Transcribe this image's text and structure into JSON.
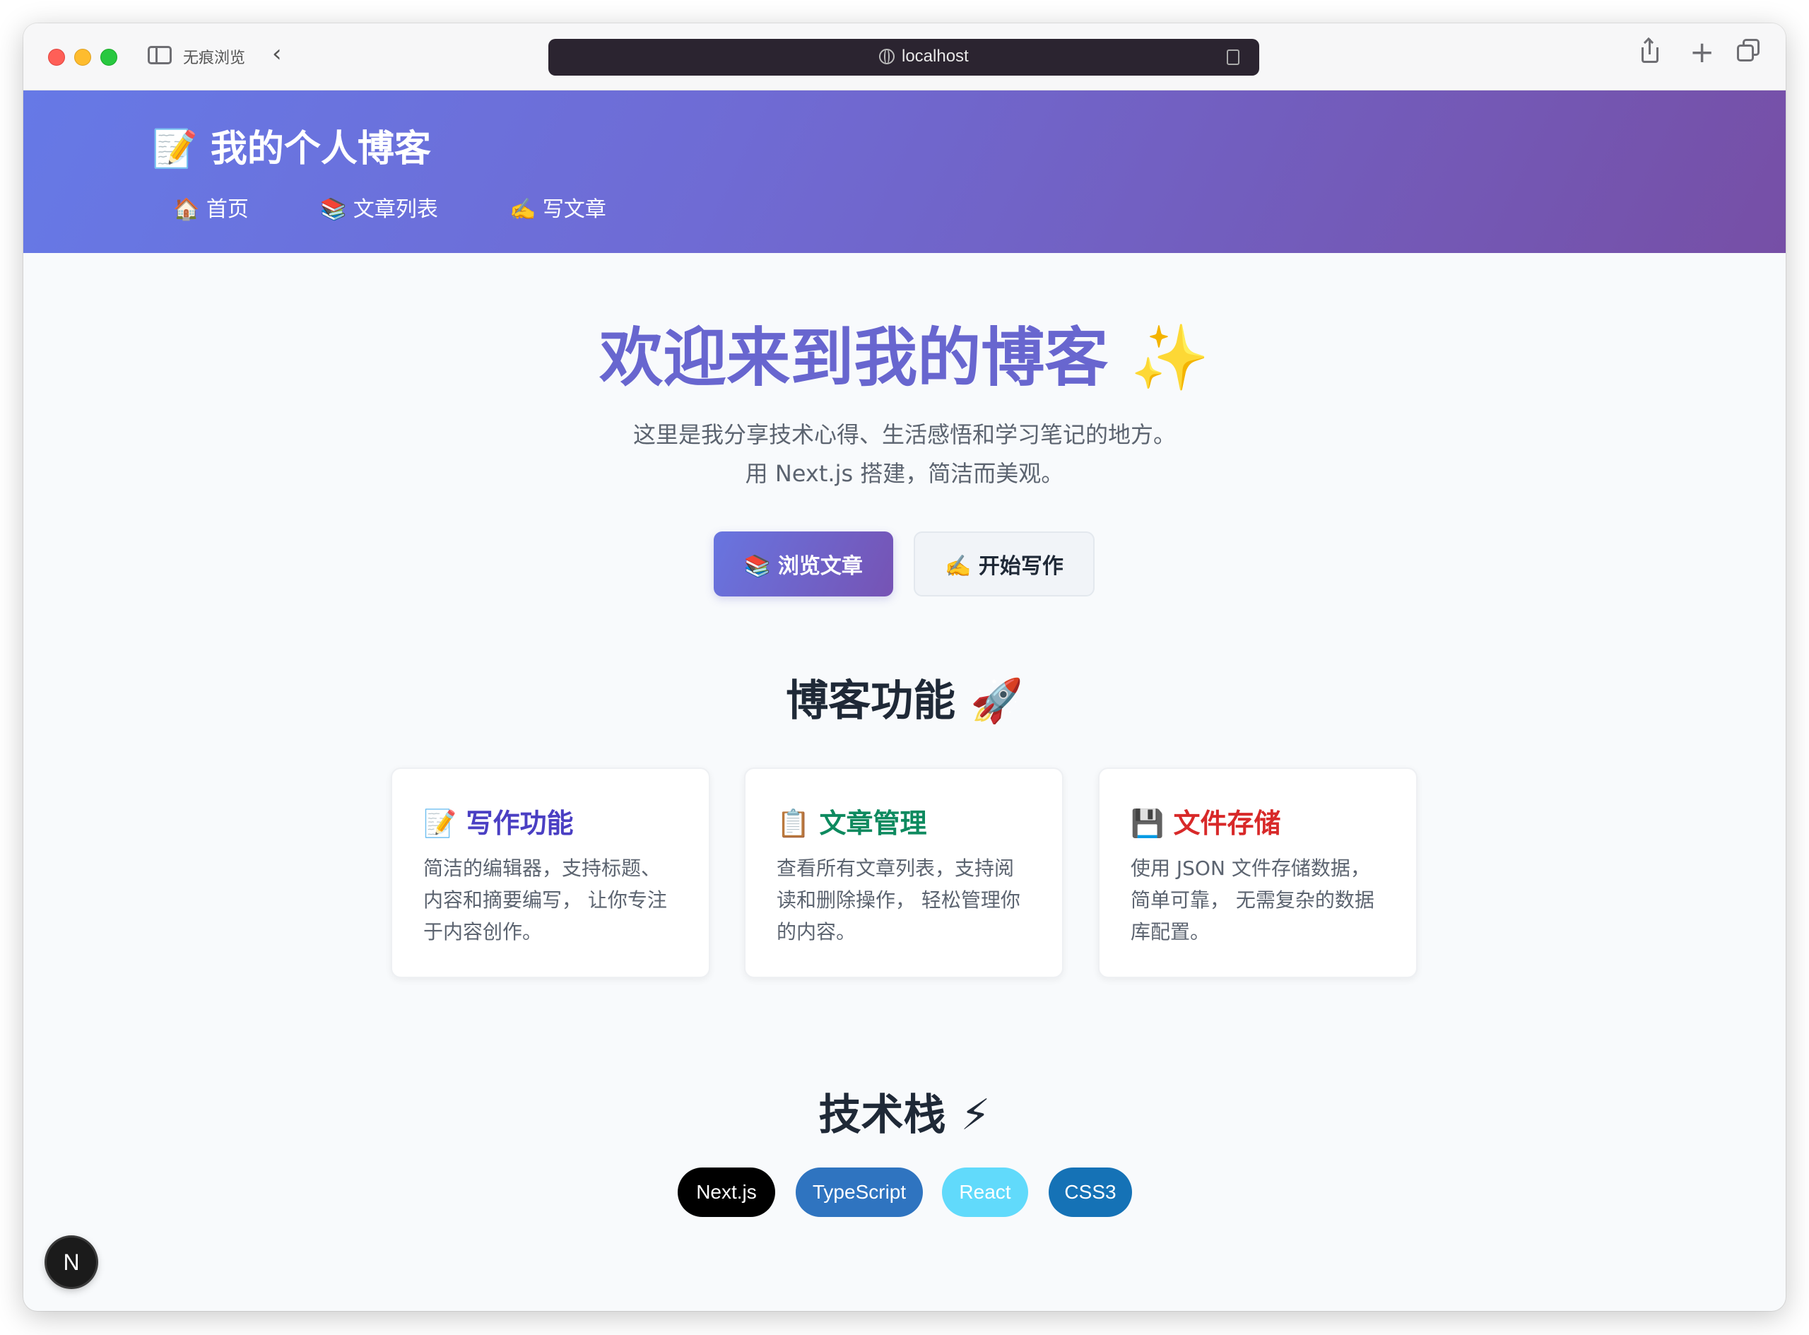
{
  "browser": {
    "private_label": "无痕浏览",
    "url": "localhost"
  },
  "site": {
    "title": "📝 我的个人博客",
    "nav": [
      {
        "label": "🏠 首页"
      },
      {
        "label": "📚 文章列表"
      },
      {
        "label": "✍️ 写文章"
      }
    ]
  },
  "hero": {
    "title": "欢迎来到我的博客 ✨",
    "subtitle_line1": "这里是我分享技术心得、生活感悟和学习笔记的地方。",
    "subtitle_line2": "用 Next.js 搭建，简洁而美观。",
    "primary_button": "📚 浏览文章",
    "secondary_button": "✍️ 开始写作"
  },
  "features": {
    "title": "博客功能 🚀",
    "cards": [
      {
        "title": "📝 写作功能",
        "lines": [
          "简洁的编辑器，支持标题、",
          "内容和摘要编写， 让你专注",
          "于内容创作。"
        ]
      },
      {
        "title": "📋 文章管理",
        "lines": [
          "查看所有文章列表，支持阅",
          "读和删除操作， 轻松管理你",
          "的内容。"
        ]
      },
      {
        "title": "💾 文件存储",
        "lines": [
          "使用 JSON 文件存储数据，",
          "简单可靠， 无需复杂的数据",
          "库配置。"
        ]
      }
    ]
  },
  "tech": {
    "title": "技术栈 ⚡",
    "tags": [
      "Next.js",
      "TypeScript",
      "React",
      "CSS3"
    ]
  },
  "dev_badge": "N",
  "colors": {
    "header_gradient_start": "#6679e6",
    "header_gradient_end": "#764fa6",
    "hero_title": "#6866cf",
    "card1_title": "#4a3fc3",
    "card2_title": "#0e8a5f",
    "card3_title": "#d82929",
    "tag_nextjs": "#000000",
    "tag_typescript": "#2f74c0",
    "tag_react": "#61dafb",
    "tag_css3": "#1572b6"
  }
}
